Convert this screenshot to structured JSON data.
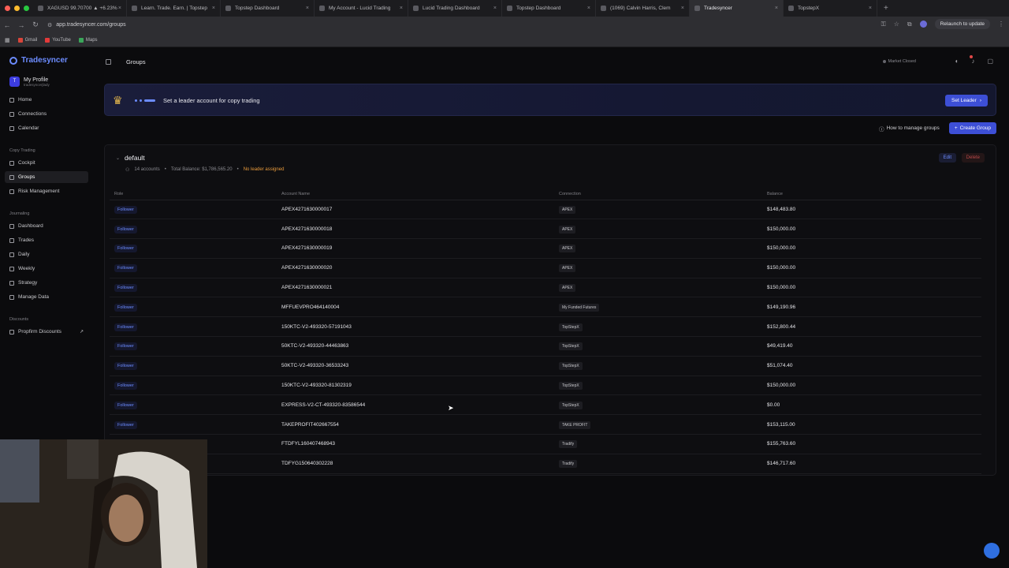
{
  "browser": {
    "tabs": [
      {
        "label": "XAGUSD 99.70700 ▲ +6.23%",
        "active": false
      },
      {
        "label": "Learn. Trade. Earn. | Topstep",
        "active": false
      },
      {
        "label": "Topstep Dashboard",
        "active": false
      },
      {
        "label": "My Account - Lucid Trading",
        "active": false
      },
      {
        "label": "Lucid Trading Dashboard",
        "active": false
      },
      {
        "label": "Topstep Dashboard",
        "active": false
      },
      {
        "label": "(1069) Calvin Harris, Clem",
        "active": false
      },
      {
        "label": "Tradesyncer",
        "active": true
      },
      {
        "label": "TopstepX",
        "active": false
      }
    ],
    "url": "app.tradesyncer.com/groups",
    "relaunch_label": "Relaunch to update",
    "bookmarks": [
      {
        "label": "Gmail",
        "color": "#d9453a"
      },
      {
        "label": "YouTube",
        "color": "#e33a3a"
      },
      {
        "label": "Maps",
        "color": "#3aa65a"
      }
    ]
  },
  "sidebar": {
    "brand": "Tradesyncer",
    "profile": {
      "name": "My Profile",
      "handle": "tradesyncerjlady",
      "initial": "T"
    },
    "main_items": [
      {
        "label": "Home",
        "icon": "home-icon"
      },
      {
        "label": "Connections",
        "icon": "link-icon"
      },
      {
        "label": "Calendar",
        "icon": "calendar-icon"
      }
    ],
    "copy_section": "Copy Trading",
    "copy_items": [
      {
        "label": "Cockpit",
        "icon": "gauge-icon"
      },
      {
        "label": "Groups",
        "icon": "groups-icon"
      },
      {
        "label": "Risk Management",
        "icon": "shield-icon"
      }
    ],
    "journal_section": "Journaling",
    "journal_items": [
      {
        "label": "Dashboard",
        "icon": "dashboard-icon"
      },
      {
        "label": "Trades",
        "icon": "list-icon"
      },
      {
        "label": "Daily",
        "icon": "calendar-day-icon"
      },
      {
        "label": "Weekly",
        "icon": "calendar-week-icon"
      },
      {
        "label": "Strategy",
        "icon": "strategy-icon"
      },
      {
        "label": "Manage Data",
        "icon": "database-icon"
      }
    ],
    "discount_section": "Discounts",
    "discount_items": [
      {
        "label": "Propfirm Discounts",
        "icon": "tag-icon"
      }
    ]
  },
  "header": {
    "title": "Groups",
    "market_status": "Market Closed"
  },
  "banner": {
    "message": "Set a leader account for copy trading",
    "button": "Set Leader"
  },
  "actions": {
    "howto": "How to manage groups",
    "create": "Create Group"
  },
  "group": {
    "name": "default",
    "accounts": "14 accounts",
    "balance": "Total Balance: $1,786,565.20",
    "leader_status": "No leader assigned",
    "edit": "Edit",
    "delete": "Delete",
    "columns": [
      "Role",
      "Account Name",
      "Connection",
      "Balance"
    ],
    "rows": [
      {
        "role": "Follower",
        "account": "APEX4271630000017",
        "connection": "APEX",
        "balance": "$148,483.80"
      },
      {
        "role": "Follower",
        "account": "APEX4271630000018",
        "connection": "APEX",
        "balance": "$150,000.00"
      },
      {
        "role": "Follower",
        "account": "APEX4271630000019",
        "connection": "APEX",
        "balance": "$150,000.00"
      },
      {
        "role": "Follower",
        "account": "APEX4271630000020",
        "connection": "APEX",
        "balance": "$150,000.00"
      },
      {
        "role": "Follower",
        "account": "APEX4271630000021",
        "connection": "APEX",
        "balance": "$150,000.00"
      },
      {
        "role": "Follower",
        "account": "MFFUEVPRO464140004",
        "connection": "My Funded Futures",
        "balance": "$149,190.96"
      },
      {
        "role": "Follower",
        "account": "150KTC-V2-493320-57191043",
        "connection": "TopStepX",
        "balance": "$152,800.44"
      },
      {
        "role": "Follower",
        "account": "50KTC-V2-493320-44463863",
        "connection": "TopStepX",
        "balance": "$49,419.40"
      },
      {
        "role": "Follower",
        "account": "50KTC-V2-493320-36533243",
        "connection": "TopStepX",
        "balance": "$51,074.40"
      },
      {
        "role": "Follower",
        "account": "150KTC-V2-493320-81302319",
        "connection": "TopStepX",
        "balance": "$150,000.00"
      },
      {
        "role": "Follower",
        "account": "EXPRESS-V2-CT-493320-83586544",
        "connection": "TopStepX",
        "balance": "$0.00"
      },
      {
        "role": "Follower",
        "account": "TAKEPROFIT402667554",
        "connection": "TAKE PROFIT",
        "balance": "$153,115.00"
      },
      {
        "role": "",
        "account": "FTDFYL160407468943",
        "connection": "Tradify",
        "balance": "$155,763.60"
      },
      {
        "role": "",
        "account": "TDFYG150640302228",
        "connection": "Tradify",
        "balance": "$146,717.60"
      }
    ]
  }
}
